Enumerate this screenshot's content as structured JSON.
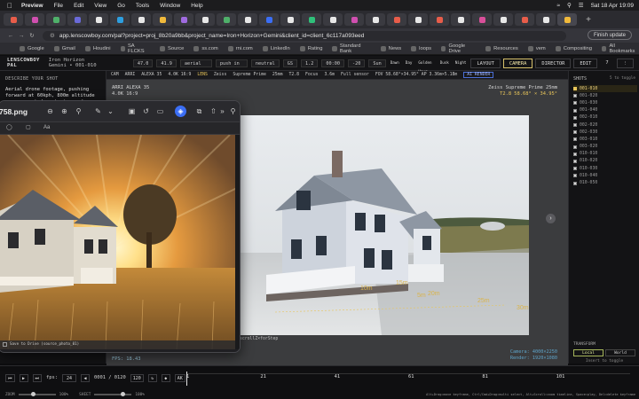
{
  "menubar": {
    "items": [
      "Preview",
      "File",
      "Edit",
      "View",
      "Go",
      "Tools",
      "Window",
      "Help"
    ],
    "datetime": "Sat 18 Apr 19:09"
  },
  "browser": {
    "url": "app.lenscowboy.com/pal?project=proj_8b20a9bb&project_name=Iron+Horizon+Gemini&client_id=client_6c117a093eed",
    "finish_update": "Finish update",
    "bookmarks": [
      "Google",
      "Gmail",
      "Houdini",
      "SA FLCKS",
      "Source",
      "ss.com",
      "rni.com",
      "LinkedIn",
      "Rating",
      "Standard Bank",
      "News",
      "loops",
      "Google Drive",
      "Resources",
      "vem",
      "Compositing",
      "All Bookmarks"
    ]
  },
  "app": {
    "brand": "LENSCOWBOY PAL",
    "project": "Iron Horizon Gemini • 001-010",
    "fields": [
      "47.0",
      "41.9",
      "aerial",
      "push in",
      "neutral",
      "GS",
      "1.2",
      "00:00",
      "-20",
      "Sun"
    ],
    "presets": [
      "Dawn",
      "Day",
      "Golden Hour",
      "Dusk",
      "Night"
    ],
    "nav": [
      {
        "label": "LAYOUT",
        "active": false
      },
      {
        "label": "CAMERA",
        "active": true
      },
      {
        "label": "DIRECTOR",
        "active": false
      },
      {
        "label": "EDIT",
        "active": false
      }
    ],
    "nav_count": "7"
  },
  "left_panel": {
    "label": "DESCRIBE YOUR SHOT",
    "description": "Aerial drone footage, pushing forward at 60kph, 800m altitude over a vast desert at grandeur"
  },
  "cam_row": [
    "CAM",
    "ARRI",
    "ALEXA 35",
    "4.0K 16:9",
    "LENS",
    "Zeiss",
    "Supreme Prime",
    "25mm",
    "T2.8",
    "Focus",
    "3.6m",
    "Full sensor",
    "FOV 58.68°×34.95° AP 3.36m×5.18m",
    "AI RENDER"
  ],
  "viewport": {
    "camera_name": "ARRI ALEXA 35",
    "resolution": "4.0K 16:9",
    "lens_name": "Zeiss Supreme Prime 25mm",
    "lens_detail": "T2.8  58.68° × 34.95°",
    "fps": "FPS: 18.43",
    "camera_readout": "Camera: 4000×2250",
    "render_readout": "Render: 1920×1080",
    "distance_labels": [
      "5m",
      "10m",
      "15m",
      "20m",
      "25m",
      "30m"
    ],
    "overlay_text": "scrollZ×forStep"
  },
  "right_panel": {
    "title": "SHOTS",
    "hint": "5 to toggle",
    "shots": [
      "001-010",
      "001-020",
      "001-030",
      "001-040",
      "002-010",
      "002-020",
      "002-030",
      "003-010",
      "003-020",
      "010-010",
      "010-020",
      "010-030",
      "010-040",
      "010-050"
    ],
    "selected_index": 0,
    "transform_label": "TRANSFORM",
    "transform_options": [
      "Local",
      "World"
    ],
    "transform_active": "Local",
    "transform_hint": "Insert to toggle"
  },
  "timeline": {
    "fps_label": "fps:",
    "fps_value": "24",
    "frame_display": "0001 / 0120",
    "length": "120",
    "marks": [
      "1",
      "21",
      "41",
      "61",
      "81",
      "101"
    ],
    "zoom_label": "ZOOM",
    "zoom_value": "100%",
    "sheet_label": "SHEET",
    "sheet_value": "100%",
    "keyframe_hint": "Alt+Drag=move keyframe, Ctrl/Cmd+Drag=multi select, Alt+Scroll=zoom timeline, Space=play, Del=delete keyframe"
  },
  "preview_window": {
    "filename": "758.png",
    "save_label": "Save to Drive (source_photo_01)",
    "zoom_icon_label": "Aa"
  }
}
